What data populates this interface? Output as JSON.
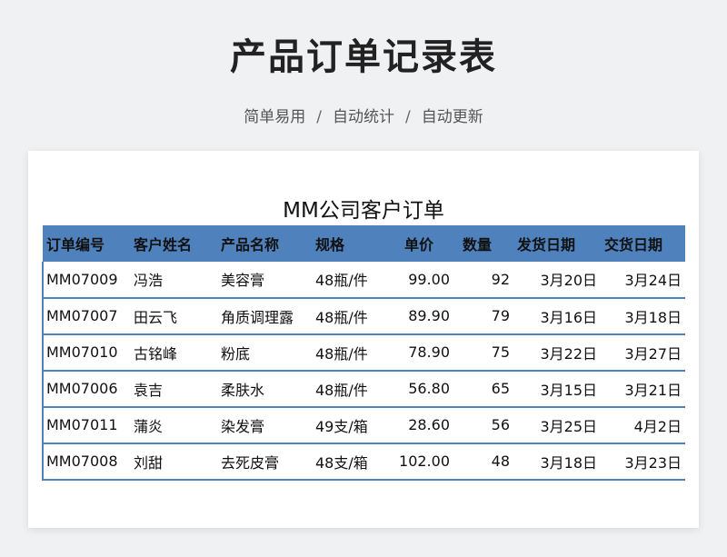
{
  "page": {
    "title": "产品订单记录表",
    "tagline": [
      "简单易用",
      "自动统计",
      "自动更新"
    ],
    "separator": "/"
  },
  "sheet": {
    "title": "MM公司客户订单",
    "columns": [
      "订单编号",
      "客户姓名",
      "产品名称",
      "规格",
      "单价",
      "数量",
      "发货日期",
      "交货日期"
    ],
    "rows": [
      [
        "MM07009",
        "冯浩",
        "美容膏",
        "48瓶/件",
        "99.00",
        "92",
        "3月20日",
        "3月24日"
      ],
      [
        "MM07007",
        "田云飞",
        "角质调理露",
        "48瓶/件",
        "89.90",
        "79",
        "3月16日",
        "3月18日"
      ],
      [
        "MM07010",
        "古铭峰",
        "粉底",
        "48瓶/件",
        "78.90",
        "75",
        "3月22日",
        "3月27日"
      ],
      [
        "MM07006",
        "袁吉",
        "柔肤水",
        "48瓶/件",
        "56.80",
        "65",
        "3月15日",
        "3月21日"
      ],
      [
        "MM07011",
        "蒲炎",
        "染发膏",
        "49支/箱",
        "28.60",
        "56",
        "3月25日",
        "4月2日"
      ],
      [
        "MM07008",
        "刘甜",
        "去死皮膏",
        "48支/箱",
        "102.00",
        "48",
        "3月18日",
        "3月23日"
      ]
    ]
  },
  "colors": {
    "header_fill": "#4f81bd",
    "border": "#4f81bd",
    "background": "#f0f1f3"
  }
}
